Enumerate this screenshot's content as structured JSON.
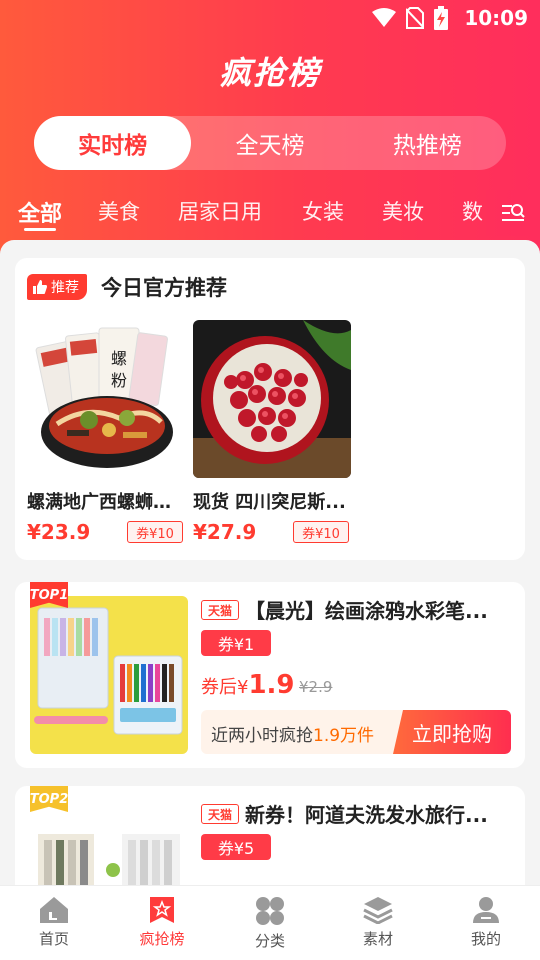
{
  "status": {
    "time": "10:09"
  },
  "title": "疯抢榜",
  "segments": [
    {
      "label": "实时榜",
      "active": true
    },
    {
      "label": "全天榜",
      "active": false
    },
    {
      "label": "热推榜",
      "active": false
    }
  ],
  "categories": [
    "全部",
    "美食",
    "居家日用",
    "女装",
    "美妆",
    "数"
  ],
  "recommend": {
    "tag": "推荐",
    "title": "今日官方推荐",
    "items": [
      {
        "name": "螺满地广西螺蛳粉...",
        "price": "¥23.9",
        "coupon": "券¥10"
      },
      {
        "name": "现货 四川突尼斯...",
        "price": "¥27.9",
        "coupon": "券¥10"
      }
    ]
  },
  "products": [
    {
      "rank": "TOP1",
      "shop": "天猫",
      "title": "【晨光】绘画涂鸦水彩笔...",
      "coupon": "券¥1",
      "after_label": "券后¥",
      "after_price": "1.9",
      "original": "¥2.9",
      "sales_prefix": "近两小时疯抢",
      "sales_value": "1.9万件",
      "buy": "立即抢购"
    },
    {
      "rank": "TOP2",
      "shop": "天猫",
      "title": "新券！阿道夫洗发水旅行...",
      "coupon": "券¥5"
    }
  ],
  "tabs": [
    {
      "label": "首页",
      "icon": "home-icon",
      "active": false
    },
    {
      "label": "疯抢榜",
      "icon": "rank-icon",
      "active": true
    },
    {
      "label": "分类",
      "icon": "category-icon",
      "active": false
    },
    {
      "label": "素材",
      "icon": "material-icon",
      "active": false
    },
    {
      "label": "我的",
      "icon": "profile-icon",
      "active": false
    }
  ],
  "colors": {
    "accent": "#ff3b3b",
    "gradient_start": "#ff5a3c",
    "gradient_end": "#ff2e5c"
  }
}
